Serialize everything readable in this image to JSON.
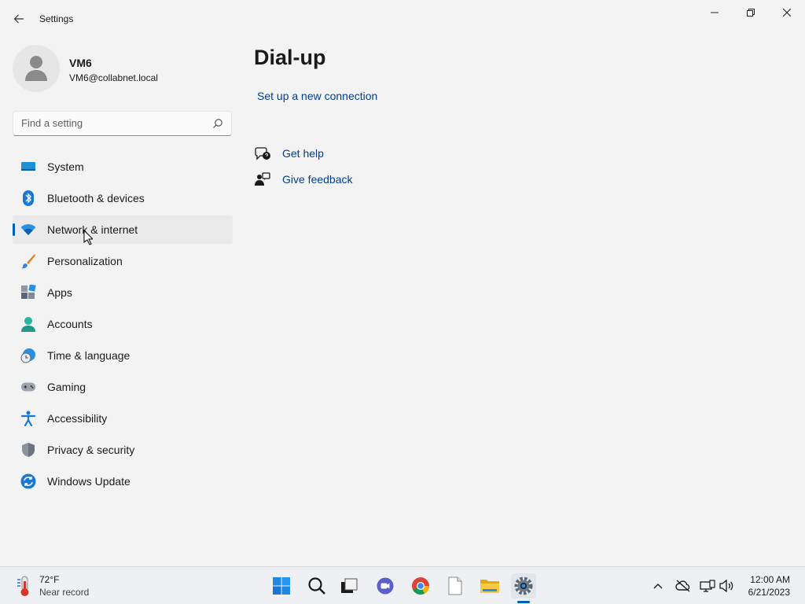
{
  "window": {
    "title": "Settings"
  },
  "profile": {
    "name": "VM6",
    "email": "VM6@collabnet.local"
  },
  "search": {
    "placeholder": "Find a setting"
  },
  "nav": {
    "items": [
      {
        "label": "System",
        "icon": "system-icon"
      },
      {
        "label": "Bluetooth & devices",
        "icon": "bluetooth-icon"
      },
      {
        "label": "Network & internet",
        "icon": "wifi-icon",
        "active": true
      },
      {
        "label": "Personalization",
        "icon": "brush-icon"
      },
      {
        "label": "Apps",
        "icon": "apps-icon"
      },
      {
        "label": "Accounts",
        "icon": "account-icon"
      },
      {
        "label": "Time & language",
        "icon": "globe-clock-icon"
      },
      {
        "label": "Gaming",
        "icon": "gamepad-icon"
      },
      {
        "label": "Accessibility",
        "icon": "accessibility-icon"
      },
      {
        "label": "Privacy & security",
        "icon": "shield-icon"
      },
      {
        "label": "Windows Update",
        "icon": "update-icon"
      }
    ]
  },
  "main": {
    "title": "Dial-up",
    "setup_link": "Set up a new connection",
    "help_label": "Get help",
    "feedback_label": "Give feedback"
  },
  "taskbar": {
    "weather_temp": "72°F",
    "weather_desc": "Near record",
    "time": "12:00 AM",
    "date": "6/21/2023"
  },
  "colors": {
    "accent": "#005fb8",
    "link": "#003e92",
    "background": "#f3f3f3"
  }
}
